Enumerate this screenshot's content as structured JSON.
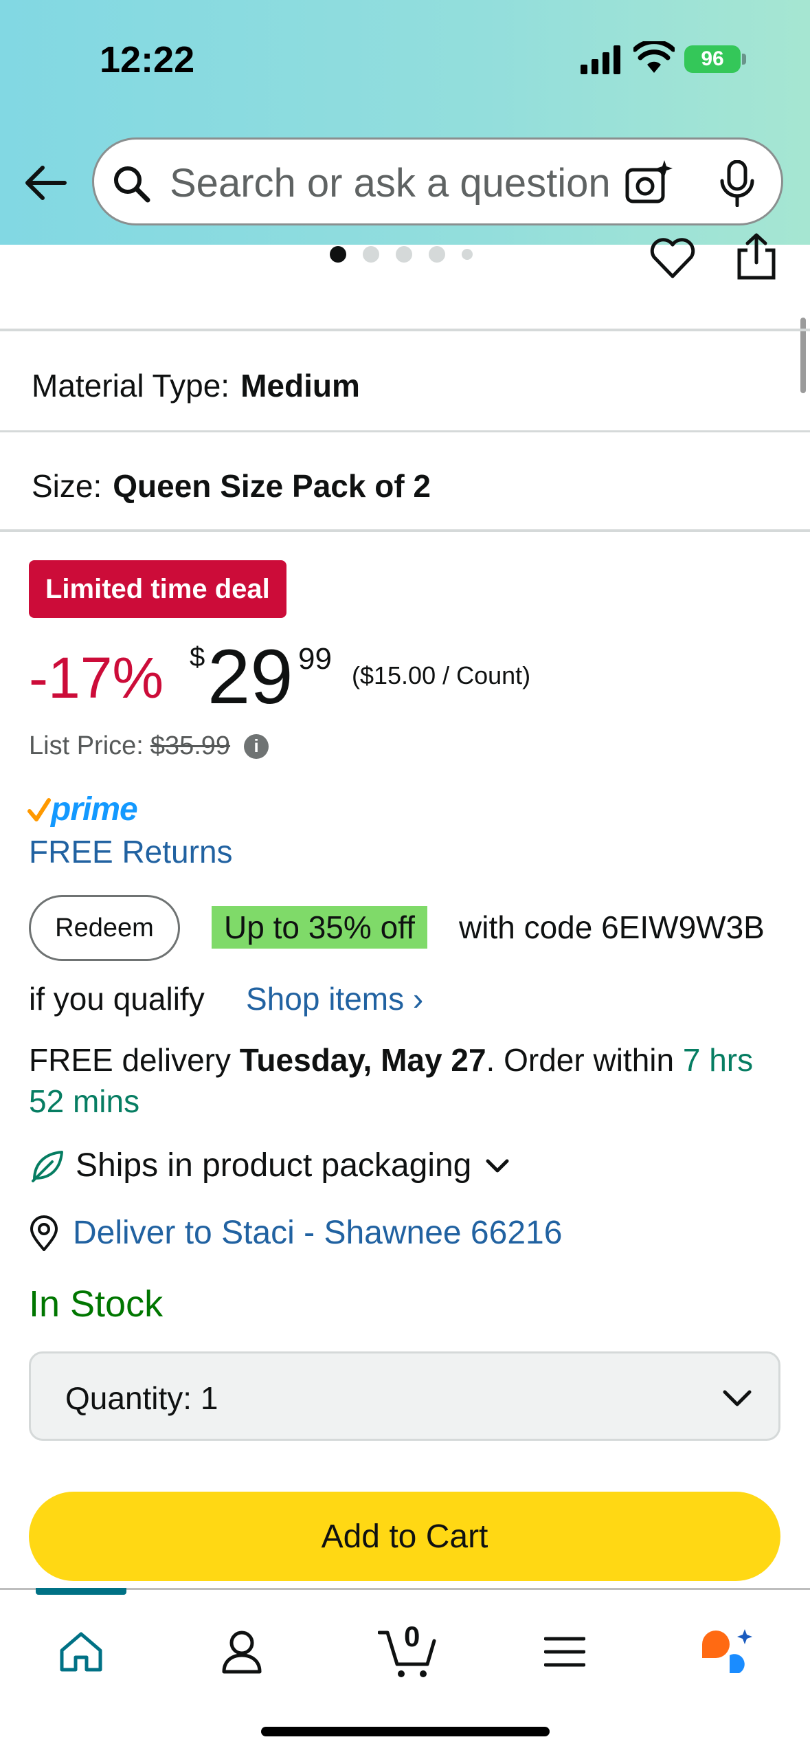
{
  "status_bar": {
    "time": "12:22",
    "battery": "96"
  },
  "search": {
    "placeholder": "Search or ask a question"
  },
  "carousel": {
    "total": 5,
    "active": 1
  },
  "variations": [
    {
      "label": "Material Type:",
      "value": "Medium"
    },
    {
      "label": "Size:",
      "value": "Queen Size Pack of 2"
    }
  ],
  "deal": {
    "badge": "Limited time deal",
    "discount": "-17%",
    "currency": "$",
    "price_whole": "29",
    "price_fraction": "99",
    "unit_price": "($15.00 / Count)",
    "list_price_label": "List Price:",
    "list_price": "$35.99"
  },
  "prime": {
    "label": "prime",
    "free_returns": "FREE Returns"
  },
  "coupon": {
    "redeem_label": "Redeem",
    "highlight": "Up to 35% off",
    "code_text": "with code 6EIW9W3B",
    "qualify_text": "if you qualify",
    "shop_items": "Shop items ›"
  },
  "delivery": {
    "prefix": "FREE delivery ",
    "date": "Tuesday, May 27",
    "middle": ". Order within ",
    "countdown": "7 hrs 52 mins"
  },
  "ships": {
    "label": "Ships in product packaging"
  },
  "deliver_to": {
    "label": "Deliver to Staci - Shawnee 66216"
  },
  "stock": {
    "label": "In Stock"
  },
  "quantity": {
    "label": "Quantity:",
    "value": "1"
  },
  "add_to_cart": {
    "label": "Add to Cart"
  },
  "bottom_nav": {
    "cart_count": "0"
  },
  "colors": {
    "deal_red": "#cc0c39",
    "link_blue": "#2162a1",
    "stock_green": "#007600",
    "cart_yellow": "#ffd814",
    "prime_blue": "#1399ff"
  }
}
